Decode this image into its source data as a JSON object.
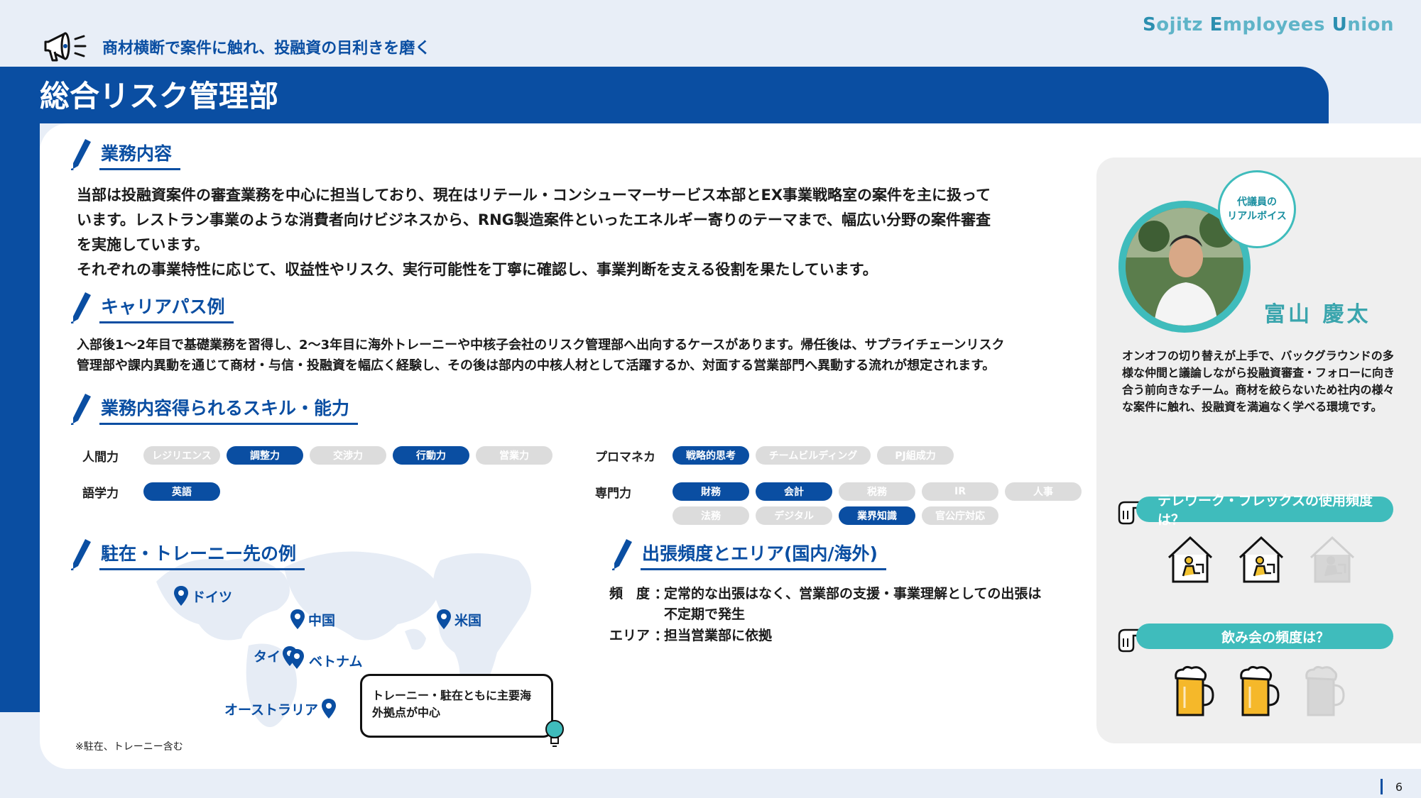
{
  "header": {
    "brand": [
      {
        "cap": "S",
        "rest": "ojitz "
      },
      {
        "cap": "E",
        "rest": "mployees "
      },
      {
        "cap": "U",
        "rest": "nion"
      }
    ],
    "tagline": "商材横断で案件に触れ、投融資の目利きを磨く",
    "title": "総合リスク管理部"
  },
  "colors": {
    "primary": "#0a4ea2",
    "teal": "#3fbcbc",
    "pill_off": "#dcdcdc"
  },
  "sections": {
    "business": {
      "heading": "業務内容",
      "lines": [
        "当部は投融資案件の審査業務を中心に担当しており、現在はリテール・コンシューマーサービス本部とEX事業戦略室の案件を主に扱って",
        "います。レストラン事業のような消費者向けビジネスから、RNG製造案件といったエネルギー寄りのテーマまで、幅広い分野の案件審査",
        "を実施しています。",
        "それぞれの事業特性に応じて、収益性やリスク、実行可能性を丁寧に確認し、事業判断を支える役割を果たしています。"
      ]
    },
    "career": {
      "heading": "キャリアパス例",
      "lines": [
        "入部後1〜2年目で基礎業務を習得し、2〜3年目に海外トレーニーや中核子会社のリスク管理部へ出向するケースがあります。帰任後は、サプライチェーンリスク",
        "管理部や課内異動を通じて商材・与信・投融資を幅広く経験し、その後は部内の中核人材として活躍するか、対面する営業部門へ異動する流れが想定されます。"
      ]
    },
    "skills": {
      "heading": "業務内容得られるスキル・能力",
      "groups": [
        {
          "label": "人間力",
          "items": [
            {
              "text": "レジリエンス",
              "on": false
            },
            {
              "text": "調整力",
              "on": true
            },
            {
              "text": "交渉力",
              "on": false
            },
            {
              "text": "行動力",
              "on": true
            },
            {
              "text": "営業力",
              "on": false
            }
          ]
        },
        {
          "label": "語学力",
          "items": [
            {
              "text": "英語",
              "on": true
            }
          ]
        },
        {
          "label": "プロマネカ",
          "items": [
            {
              "text": "戦略的思考",
              "on": true
            },
            {
              "text": "チームビルディング",
              "on": false
            },
            {
              "text": "PJ組成力",
              "on": false
            }
          ]
        },
        {
          "label": "専門力",
          "items": [
            {
              "text": "財務",
              "on": true
            },
            {
              "text": "会計",
              "on": true
            },
            {
              "text": "税務",
              "on": false
            },
            {
              "text": "IR",
              "on": false
            },
            {
              "text": "人事",
              "on": false
            },
            {
              "text": "法務",
              "on": false
            },
            {
              "text": "デジタル",
              "on": false
            },
            {
              "text": "業界知識",
              "on": true
            },
            {
              "text": "官公庁対応",
              "on": false
            }
          ]
        }
      ]
    },
    "overseas": {
      "heading": "駐在・トレーニー先の例",
      "pins": [
        "ドイツ",
        "中国",
        "米国",
        "タイ",
        "ベトナム",
        "オーストラリア"
      ],
      "callout": [
        "トレーニー・駐在ともに主要海",
        "外拠点が中心"
      ],
      "note": "※駐在、トレーニー含む"
    },
    "travel": {
      "heading": "出張頻度とエリア(国内/海外)",
      "freq_label": "頻　度 ：",
      "freq_lines": [
        "定常的な出張はなく、営業部の支援・事業理解としての出張は",
        "不定期で発生"
      ],
      "area_label": "エリア ：",
      "area_value": "担当営業部に依拠"
    }
  },
  "representative": {
    "bubble": [
      "代議員の",
      "リアルボイス"
    ],
    "name": "富山 慶太",
    "desc": "オンオフの切り替えが上手で、バックグラウンドの多様な仲間と議論しながら投融資審査・フォローに向き合う前向きなチーム。商材を絞らないため社内の様々な案件に触れ、投融資を満遍なく学べる環境です。",
    "telework_q": "テレワーク・フレックスの使用頻度は？",
    "telework_level": 2,
    "telework_max": 3,
    "drink_q": "飲み会の頻度は？",
    "drink_level": 2,
    "drink_max": 3
  },
  "page_number": "6"
}
